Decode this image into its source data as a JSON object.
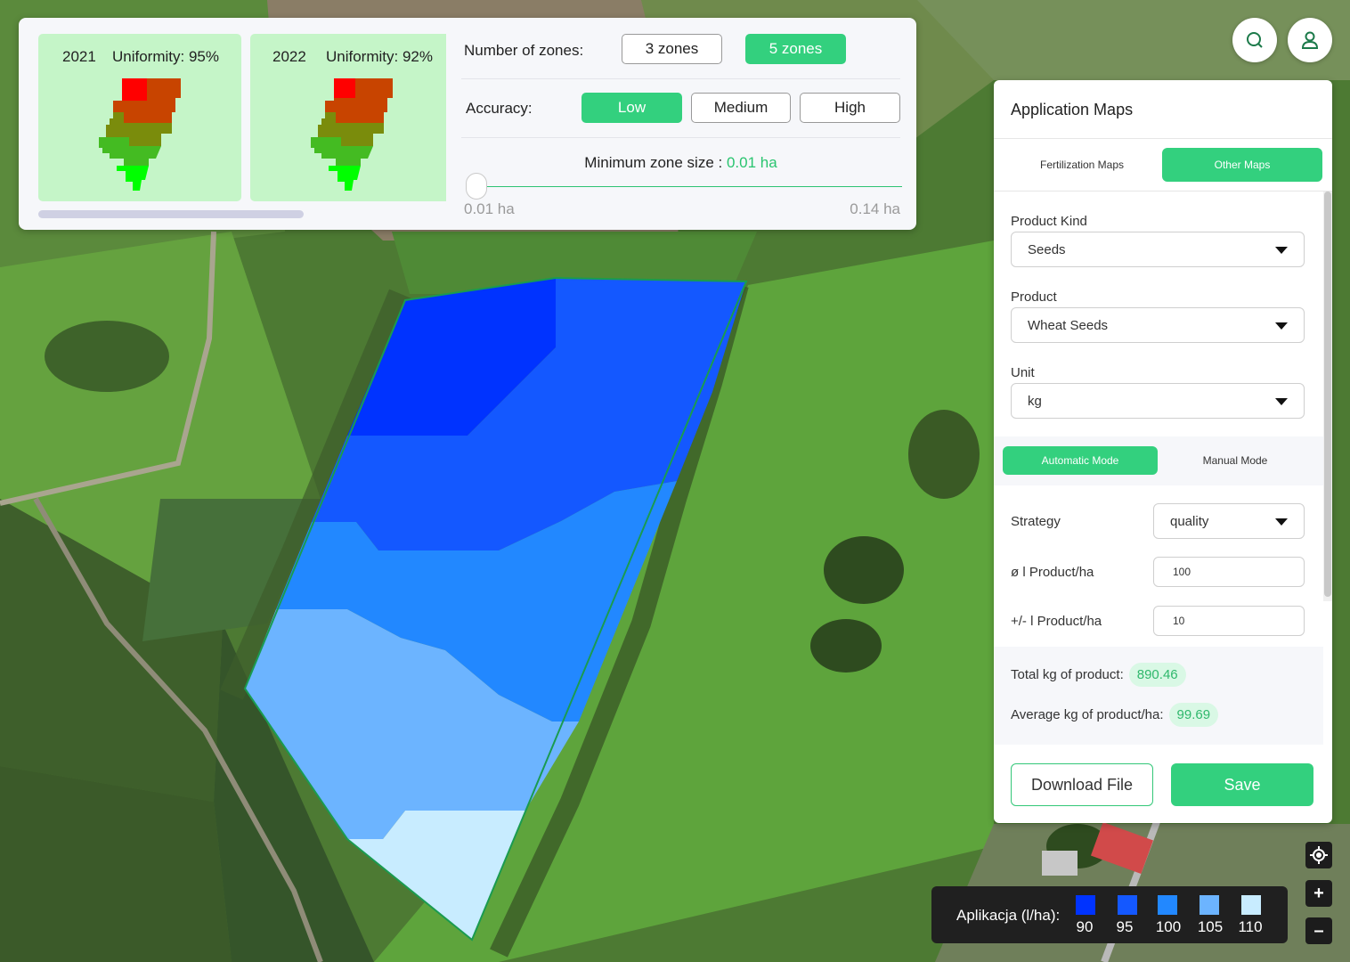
{
  "zone_previews": [
    {
      "year": "2021",
      "uniformity_label": "Uniformity",
      "uniformity_value": ": 95%"
    },
    {
      "year": "2022",
      "uniformity_label": "Uniformity",
      "uniformity_value": ": 92%"
    }
  ],
  "zones": {
    "label": "Number of zones:",
    "options": [
      "3 zones",
      "5 zones"
    ],
    "selected": "5 zones"
  },
  "accuracy": {
    "label": "Accuracy:",
    "options": [
      "Low",
      "Medium",
      "High"
    ],
    "selected": "Low"
  },
  "min_zone": {
    "label": "Minimum zone size :",
    "value": "0.01 ha",
    "min_label": "0.01 ha",
    "max_label": "0.14 ha",
    "slider_fraction": 0
  },
  "header_buttons": {
    "search_icon": "search-icon",
    "user_icon": "user-icon"
  },
  "panel": {
    "title": "Application Maps",
    "tabs": [
      "Fertilization Maps",
      "Other Maps"
    ],
    "active_tab": "Other Maps",
    "product_kind": {
      "label": "Product Kind",
      "value": "Seeds"
    },
    "product": {
      "label": "Product",
      "value": "Wheat Seeds"
    },
    "unit": {
      "label": "Unit",
      "value": "kg"
    },
    "modes": [
      "Automatic Mode",
      "Manual Mode"
    ],
    "active_mode": "Automatic Mode",
    "strategy": {
      "label": "Strategy",
      "value": "quality"
    },
    "avg_rate": {
      "label": "ø l Product/ha",
      "value": "100"
    },
    "variation": {
      "label": "+/- l Product/ha",
      "value": "10"
    },
    "total": {
      "label": "Total kg of product:",
      "value": "890.46"
    },
    "average": {
      "label": "Average kg of product/ha:",
      "value": "99.69"
    },
    "download_label": "Download File",
    "save_label": "Save"
  },
  "map_controls": {
    "locate_icon": "crosshair-icon",
    "zoom_in": "+",
    "zoom_out": "–"
  },
  "legend": {
    "title": "Aplikacja (l/ha):",
    "items": [
      {
        "value": "90",
        "color": "#0033ff"
      },
      {
        "value": "95",
        "color": "#1458ff"
      },
      {
        "value": "100",
        "color": "#2288ff"
      },
      {
        "value": "105",
        "color": "#6cb4ff"
      },
      {
        "value": "110",
        "color": "#c8ecff"
      }
    ]
  },
  "colors": {
    "accent": "#33d07e",
    "zone_high": "#ff0000",
    "zone_low": "#00ff00"
  }
}
